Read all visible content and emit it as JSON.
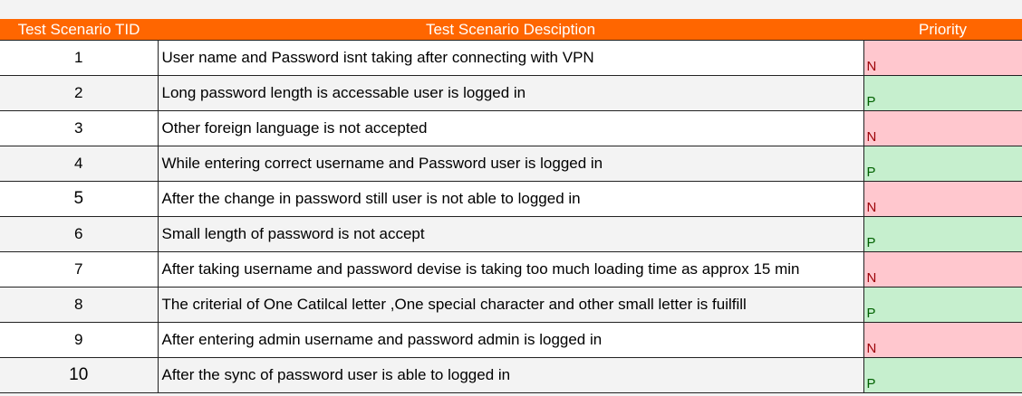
{
  "table": {
    "headers": [
      "Test Scenario TID",
      "Test Scenario Desciption",
      "Priority"
    ],
    "rows": [
      {
        "tid": "1",
        "desc": "User name and Password isnt taking after connecting with VPN",
        "priority": "N"
      },
      {
        "tid": "2",
        "desc": "Long password length is accessable user is logged in",
        "priority": "P"
      },
      {
        "tid": "3",
        "desc": "Other foreign language is not accepted",
        "priority": "N"
      },
      {
        "tid": "4",
        "desc": "While entering correct username and Password user is logged in",
        "priority": "P"
      },
      {
        "tid": "5",
        "desc": "After the change in password still user is not able to logged in",
        "priority": "N"
      },
      {
        "tid": "6",
        "desc": "Small length of password is not accept",
        "priority": "P"
      },
      {
        "tid": "7",
        "desc": "After taking username and password devise is taking too much loading time as approx 15 min",
        "priority": "N"
      },
      {
        "tid": "8",
        "desc": "The criterial of One Catilcal letter ,One special character and other small letter is fuilfill",
        "priority": "P"
      },
      {
        "tid": "9",
        "desc": "After entering admin username and password admin is logged in",
        "priority": "N"
      },
      {
        "tid": "10",
        "desc": "After the sync of password user is able to logged in",
        "priority": "P"
      }
    ]
  },
  "colors": {
    "header_bg": "#ff6600",
    "negative_bg": "#ffc7ce",
    "negative_text": "#9c0006",
    "positive_bg": "#c6efce",
    "positive_text": "#006100"
  }
}
